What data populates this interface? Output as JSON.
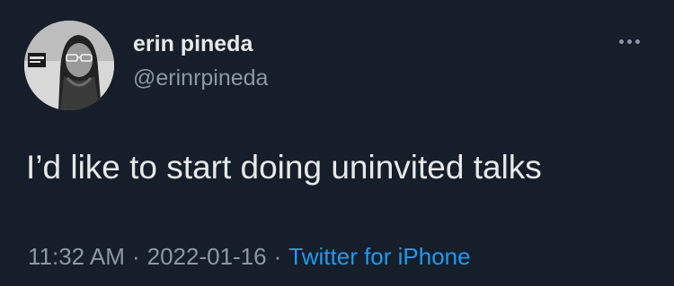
{
  "tweet": {
    "author": {
      "display_name": "erin pineda",
      "handle": "@erinrpineda",
      "avatar_icon": "profile-photo"
    },
    "more_icon": "ellipsis-icon",
    "text": "I’d like to start doing uninvited talks",
    "time": "11:32 AM",
    "separator": "·",
    "date": "2022-01-16",
    "source": "Twitter for iPhone"
  },
  "colors": {
    "background": "#151e29",
    "primary_text": "#e7e9ea",
    "secondary_text": "#8b98a5",
    "link": "#1d9bf0"
  }
}
